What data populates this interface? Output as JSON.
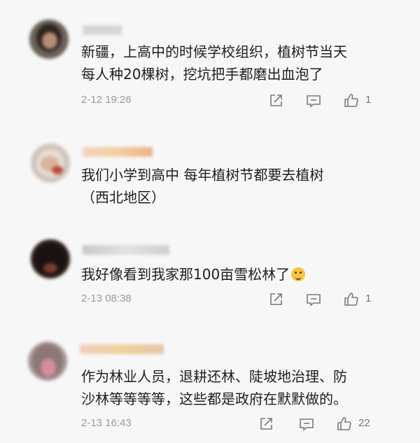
{
  "comments": [
    {
      "text_lines": [
        "新疆，上高中的时候学校组织，植树节当天",
        "每人种20棵树，挖坑把手都磨出血泡了"
      ],
      "time": "2-12 19:26",
      "likes": "1"
    },
    {
      "text_lines": [
        "我们小学到高中 每年植树节都要去植树",
        "（西北地区）"
      ]
    },
    {
      "text_lines": [
        "我好像看到我家那100亩雪松林了"
      ],
      "time": "2-13 08:38",
      "likes": "1"
    },
    {
      "text_lines": [
        "作为林业人员，退耕还林、陡坡地治理、防",
        "沙林等等等等，这些都是政府在默默做的。"
      ],
      "time": "2-13 16:43",
      "likes": "22"
    }
  ],
  "icons": {
    "share": "share-icon",
    "reply": "comment-icon",
    "like": "thumbs-up-icon",
    "emoji": "emoji-icon"
  },
  "colors": {
    "background": "#f7f7f7",
    "text": "#1e1e1e",
    "meta": "#9a9a9a"
  }
}
